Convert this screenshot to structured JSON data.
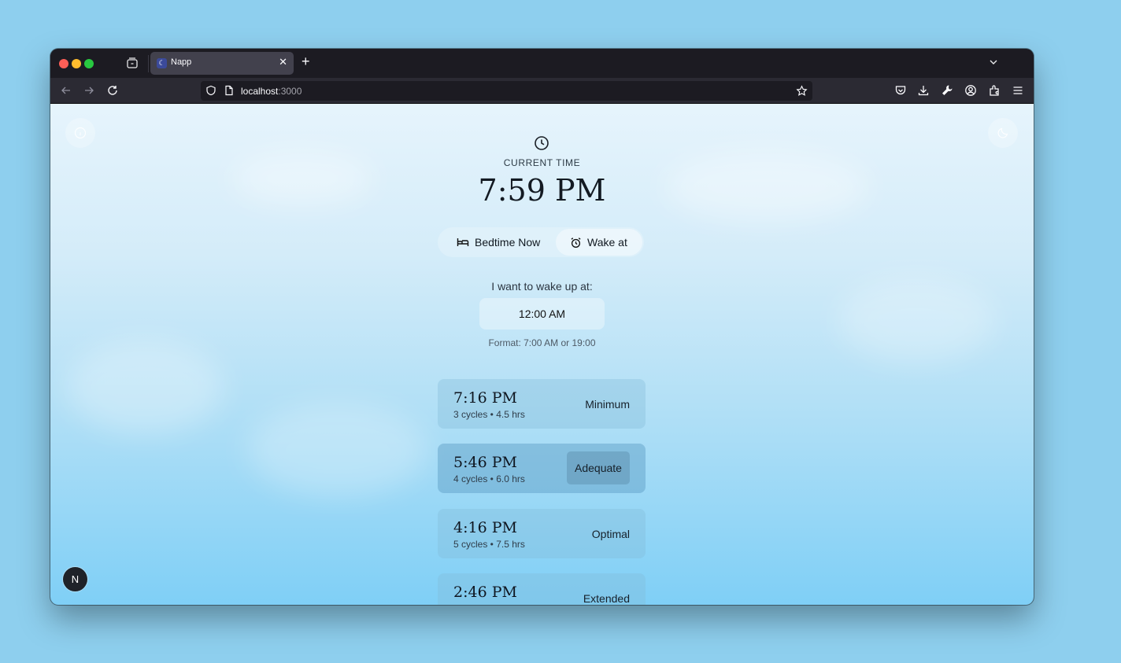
{
  "browser": {
    "tab_title": "Napp",
    "url_host": "localhost",
    "url_port": ":3000"
  },
  "app": {
    "current_time_label": "CURRENT TIME",
    "current_time": "7:59 PM",
    "modes": [
      {
        "label": "Bedtime Now",
        "icon": "bed-icon",
        "active": false
      },
      {
        "label": "Wake at",
        "icon": "alarm-clock-icon",
        "active": true
      }
    ],
    "wake_prompt": "I want to wake up at:",
    "wake_input_value": "12:00 AM",
    "format_hint": "Format: 7:00 AM or 19:00",
    "results": [
      {
        "time": "7:16 PM",
        "meta": "3 cycles • 4.5 hrs",
        "tag": "Minimum"
      },
      {
        "time": "5:46 PM",
        "meta": "4 cycles • 6.0 hrs",
        "tag": "Adequate"
      },
      {
        "time": "4:16 PM",
        "meta": "5 cycles • 7.5 hrs",
        "tag": "Optimal"
      },
      {
        "time": "2:46 PM",
        "meta": "",
        "tag": "Extended"
      }
    ],
    "badge_letter": "N"
  },
  "colors": {
    "backdrop": "#8ecfee",
    "browser_chrome": "#1c1b22",
    "accent_text": "#131a22"
  }
}
